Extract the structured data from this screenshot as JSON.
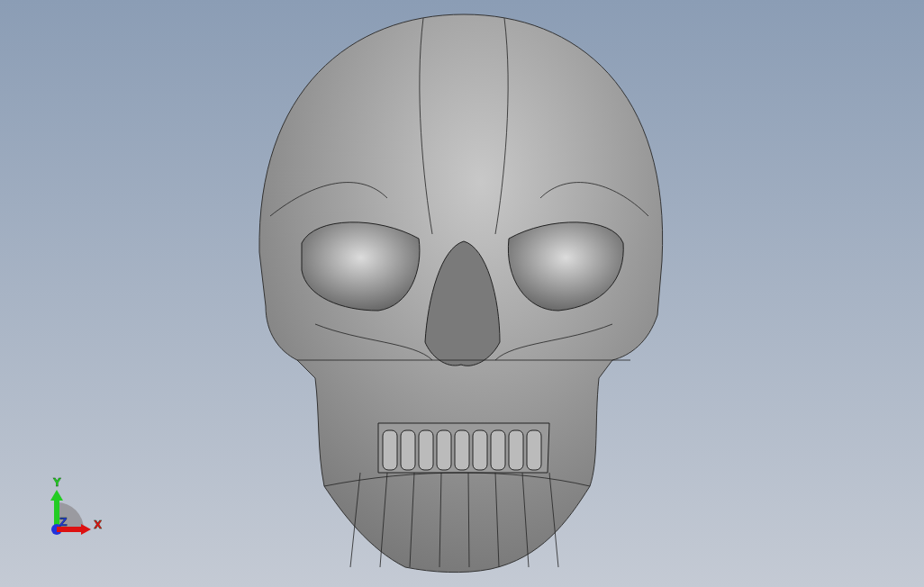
{
  "viewport": {
    "triad": {
      "axes": [
        {
          "label": "Y",
          "color": "#22cc22"
        },
        {
          "label": "Z",
          "color": "#2233dd"
        },
        {
          "label": "X",
          "color": "#dd1111"
        }
      ]
    }
  }
}
